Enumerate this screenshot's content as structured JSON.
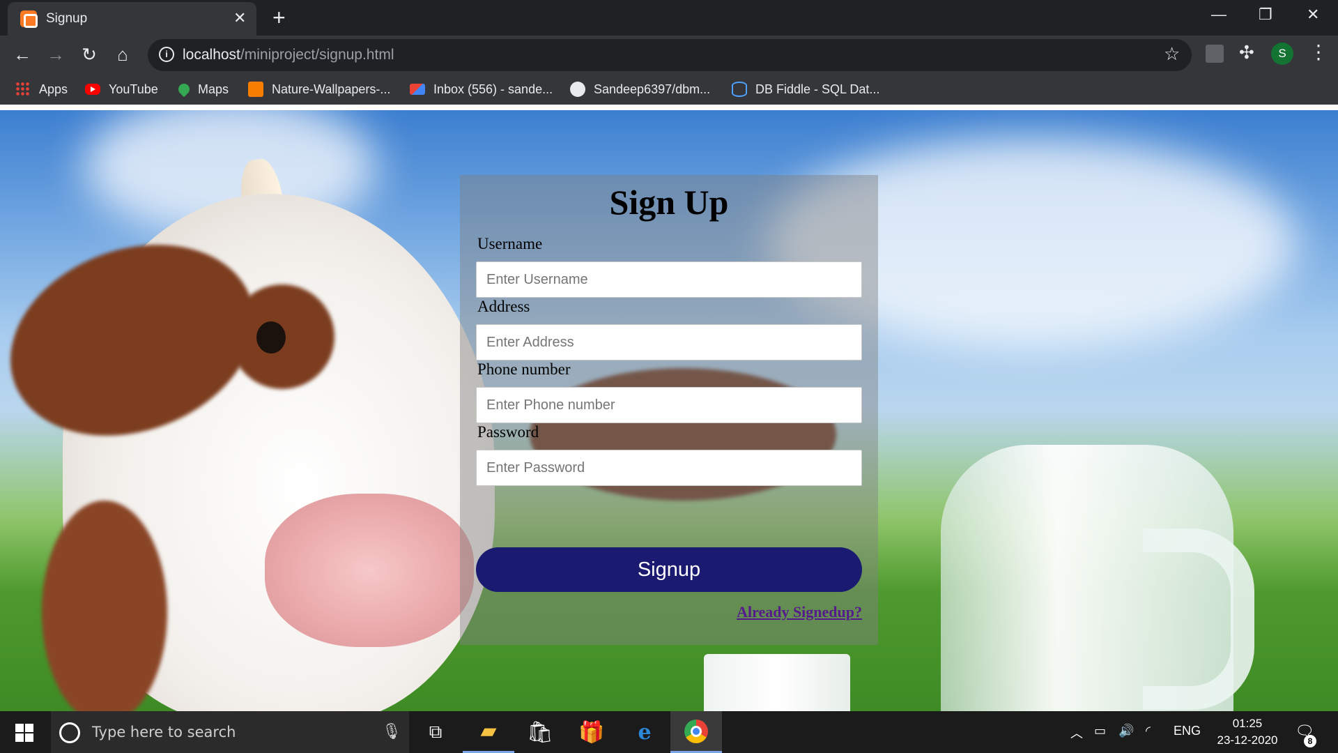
{
  "browser": {
    "tab_title": "Signup",
    "tab_close": "✕",
    "new_tab": "+",
    "window_controls": {
      "minimize": "—",
      "restore": "❐",
      "close": "✕"
    },
    "url_host": "localhost",
    "url_path": "/miniproject/signup.html",
    "profile_initial": "S",
    "bookmarks": [
      {
        "label": "Apps",
        "icon": "apps-grid-icon"
      },
      {
        "label": "YouTube",
        "icon": "youtube-icon"
      },
      {
        "label": "Maps",
        "icon": "maps-icon"
      },
      {
        "label": "Nature-Wallpapers-...",
        "icon": "blogger-icon"
      },
      {
        "label": "Inbox (556) - sande...",
        "icon": "gmail-icon"
      },
      {
        "label": "Sandeep6397/dbm...",
        "icon": "github-icon"
      },
      {
        "label": "DB Fiddle - SQL Dat...",
        "icon": "database-icon"
      }
    ]
  },
  "form": {
    "title": "Sign Up",
    "fields": [
      {
        "label": "Username",
        "placeholder": "Enter Username",
        "value": ""
      },
      {
        "label": "Address",
        "placeholder": "Enter Address",
        "value": ""
      },
      {
        "label": "Phone number",
        "placeholder": "Enter Phone number",
        "value": ""
      },
      {
        "label": "Password",
        "placeholder": "Enter Password",
        "value": ""
      }
    ],
    "submit_label": "Signup",
    "login_link": "Already Signedup?",
    "button_color": "#1a1a70",
    "link_color": "#551a8b"
  },
  "taskbar": {
    "search_placeholder": "Type here to search",
    "tray_language": "ENG",
    "time": "01:25",
    "date": "23-12-2020",
    "notification_count": "8"
  }
}
